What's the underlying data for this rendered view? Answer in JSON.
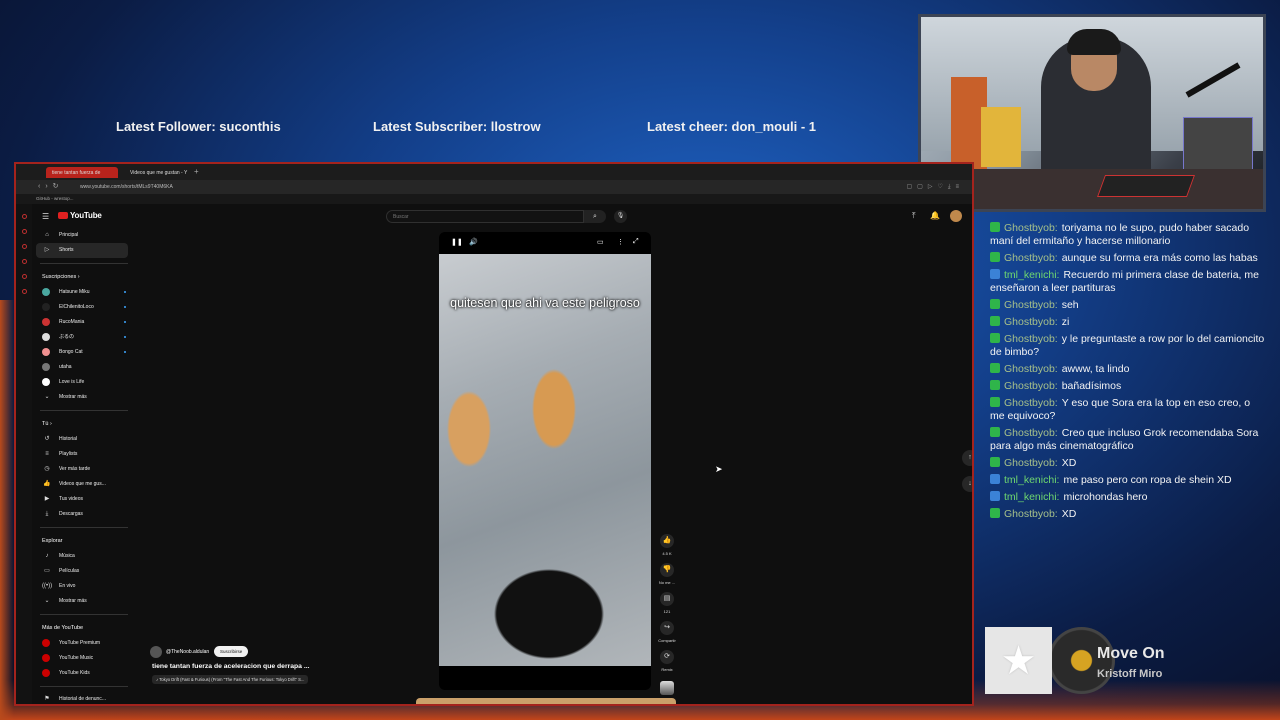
{
  "banner": {
    "follower": "Latest Follower: suconthis",
    "subscriber": "Latest Subscriber: llostrow",
    "cheer": "Latest cheer: don_mouli - 1"
  },
  "chat": [
    {
      "badge": "green",
      "user": "Ghostbyob:",
      "style": "ghost",
      "text": "toriyama no le supo, pudo haber sacado maní del ermitaño y hacerse millonario"
    },
    {
      "badge": "green",
      "user": "Ghostbyob:",
      "style": "ghost",
      "text": "aunque su forma era más como las habas"
    },
    {
      "badge": "blue",
      "user": "tml_kenichi:",
      "style": "tml",
      "text": "Recuerdo mi primera clase de bateria, me enseñaron a leer partituras"
    },
    {
      "badge": "green",
      "user": "Ghostbyob:",
      "style": "ghost",
      "text": "seh"
    },
    {
      "badge": "green",
      "user": "Ghostbyob:",
      "style": "ghost",
      "text": "zi"
    },
    {
      "badge": "green",
      "user": "Ghostbyob:",
      "style": "ghost",
      "text": "y le preguntaste a row por lo del camioncito de bimbo?"
    },
    {
      "badge": "green",
      "user": "Ghostbyob:",
      "style": "ghost",
      "text": "awww, ta lindo"
    },
    {
      "badge": "green",
      "user": "Ghostbyob:",
      "style": "ghost",
      "text": "bañadísimos"
    },
    {
      "badge": "green",
      "user": "Ghostbyob:",
      "style": "ghost",
      "text": "Y eso que Sora era la top en eso creo, o me equivoco?"
    },
    {
      "badge": "green",
      "user": "Ghostbyob:",
      "style": "ghost",
      "text": "Creo que incluso Grok recomendaba Sora para algo más cinematográfico"
    },
    {
      "badge": "green",
      "user": "Ghostbyob:",
      "style": "ghost",
      "text": "XD"
    },
    {
      "badge": "blue",
      "user": "tml_kenichi:",
      "style": "tml",
      "text": "me paso pero con ropa de shein XD"
    },
    {
      "badge": "blue",
      "user": "tml_kenichi:",
      "style": "tml",
      "text": "microhondas hero"
    },
    {
      "badge": "green",
      "user": "Ghostbyob:",
      "style": "ghost",
      "text": "XD"
    }
  ],
  "now_playing": {
    "title": "Move On",
    "artist": "Kristoff Miro"
  },
  "browser": {
    "tab_active": "tiene tantan fuerza de",
    "tab_2": "Videos que me gustan - Y",
    "new_tab": "+",
    "url": "www.youtube.com/shorts/tMLs9T40M6KA",
    "bookmark": "GitHub - wrestop..."
  },
  "youtube": {
    "logo": "YouTube",
    "search_placeholder": "Buscar",
    "sidebar": {
      "main": [
        {
          "icon": "⌂",
          "label": "Principal"
        },
        {
          "icon": "▷",
          "label": "Shorts",
          "selected": true
        }
      ],
      "subs_header": "Suscripciones  ›",
      "subs": [
        {
          "label": "Hatsune Miku",
          "color": "#4aa7a0"
        },
        {
          "label": "ElChilenitoLoco",
          "color": "#222"
        },
        {
          "label": "RucoMania",
          "color": "#c33"
        },
        {
          "label": "ぶるの",
          "color": "#ddd"
        },
        {
          "label": "Bongo Cat",
          "color": "#f09090"
        },
        {
          "label": "utaha",
          "color": "#777"
        },
        {
          "label": "Love is Life",
          "color": "#fff"
        },
        {
          "label": "Mostrar más",
          "icon": "⌄"
        }
      ],
      "you_header": "Tú  ›",
      "you": [
        {
          "icon": "↺",
          "label": "Historial"
        },
        {
          "icon": "≡",
          "label": "Playlists"
        },
        {
          "icon": "◷",
          "label": "Ver más tarde"
        },
        {
          "icon": "👍",
          "label": "Videos que me gus..."
        },
        {
          "icon": "▶",
          "label": "Tus videos"
        },
        {
          "icon": "⤓",
          "label": "Descargas"
        }
      ],
      "explore_header": "Explorar",
      "explore": [
        {
          "icon": "♪",
          "label": "Música"
        },
        {
          "icon": "▭",
          "label": "Películas"
        },
        {
          "icon": "((•))",
          "label": "En vivo"
        },
        {
          "icon": "⌄",
          "label": "Mostrar más"
        }
      ],
      "more_header": "Más de YouTube",
      "more": [
        {
          "label": "YouTube Premium"
        },
        {
          "label": "YouTube Music"
        },
        {
          "label": "YouTube Kids"
        }
      ],
      "footer": {
        "icon": "⚑",
        "label": "Historial de denunc..."
      }
    },
    "short": {
      "caption": "quitesen que ahi va este peligroso",
      "likes": "4.5 K",
      "dislike_label": "No me ...",
      "comments": "121",
      "share": "Compartir",
      "remix": "Remix"
    },
    "meta": {
      "channel": "@TheNoob.aldulan",
      "subscribe": "Suscribirse",
      "title": "tiene tantan fuerza de aceleracion que derrapa ...",
      "music": "♪ Tokyo Drift (Fast & Furious) (From \"The Fast And The Furious: Tokyo Drift\" S..."
    }
  },
  "colors": {
    "accent_red": "#b8231c",
    "yt_red": "#e02020"
  }
}
